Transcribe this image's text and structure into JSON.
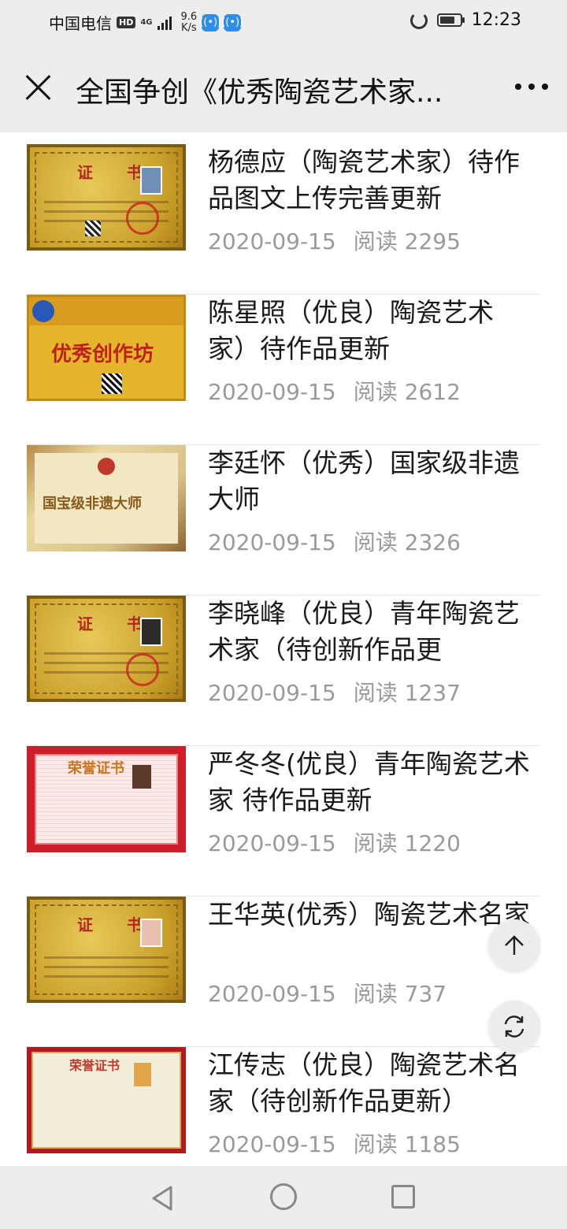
{
  "status_bar": {
    "carrier": "中国电信",
    "hd": "HD",
    "network": "4G",
    "speed_value": "9.6",
    "speed_unit": "K/s",
    "time": "12:23",
    "battery_level": 0.75
  },
  "header": {
    "title": "全国争创《优秀陶瓷艺术家..."
  },
  "articles": [
    {
      "title": "杨德应（陶瓷艺术家）待作品图文上传完善更新",
      "date": "2020-09-15",
      "reads_label": "阅读",
      "reads": "2295",
      "thumb_text": "证 书"
    },
    {
      "title": "陈星照（优良）陶瓷艺术家）待作品更新",
      "date": "2020-09-15",
      "reads_label": "阅读",
      "reads": "2612",
      "thumb_text": "优秀创作坊"
    },
    {
      "title": "李廷怀（优秀）国家级非遗大师",
      "date": "2020-09-15",
      "reads_label": "阅读",
      "reads": "2326",
      "thumb_text": "国宝级非遗大师"
    },
    {
      "title": "李晓峰（优良）青年陶瓷艺术家（待创新作品更",
      "date": "2020-09-15",
      "reads_label": "阅读",
      "reads": "1237",
      "thumb_text": "证 书"
    },
    {
      "title": "严冬冬(优良）青年陶瓷艺术家 待作品更新",
      "date": "2020-09-15",
      "reads_label": "阅读",
      "reads": "1220",
      "thumb_text": "荣誉证书"
    },
    {
      "title": "王华英(优秀）陶瓷艺术名家",
      "date": "2020-09-15",
      "reads_label": "阅读",
      "reads": "737",
      "thumb_text": "证 书"
    },
    {
      "title": "江传志（优良）陶瓷艺术名家（待创新作品更新）",
      "date": "2020-09-15",
      "reads_label": "阅读",
      "reads": "1185",
      "thumb_text": "荣誉证书"
    }
  ],
  "icons": {
    "close": "close-icon",
    "more": "more-icon",
    "scroll_top": "arrow-up-icon",
    "refresh": "refresh-icon",
    "nav_back": "triangle-back-icon",
    "nav_home": "circle-home-icon",
    "nav_recent": "square-recent-icon"
  }
}
